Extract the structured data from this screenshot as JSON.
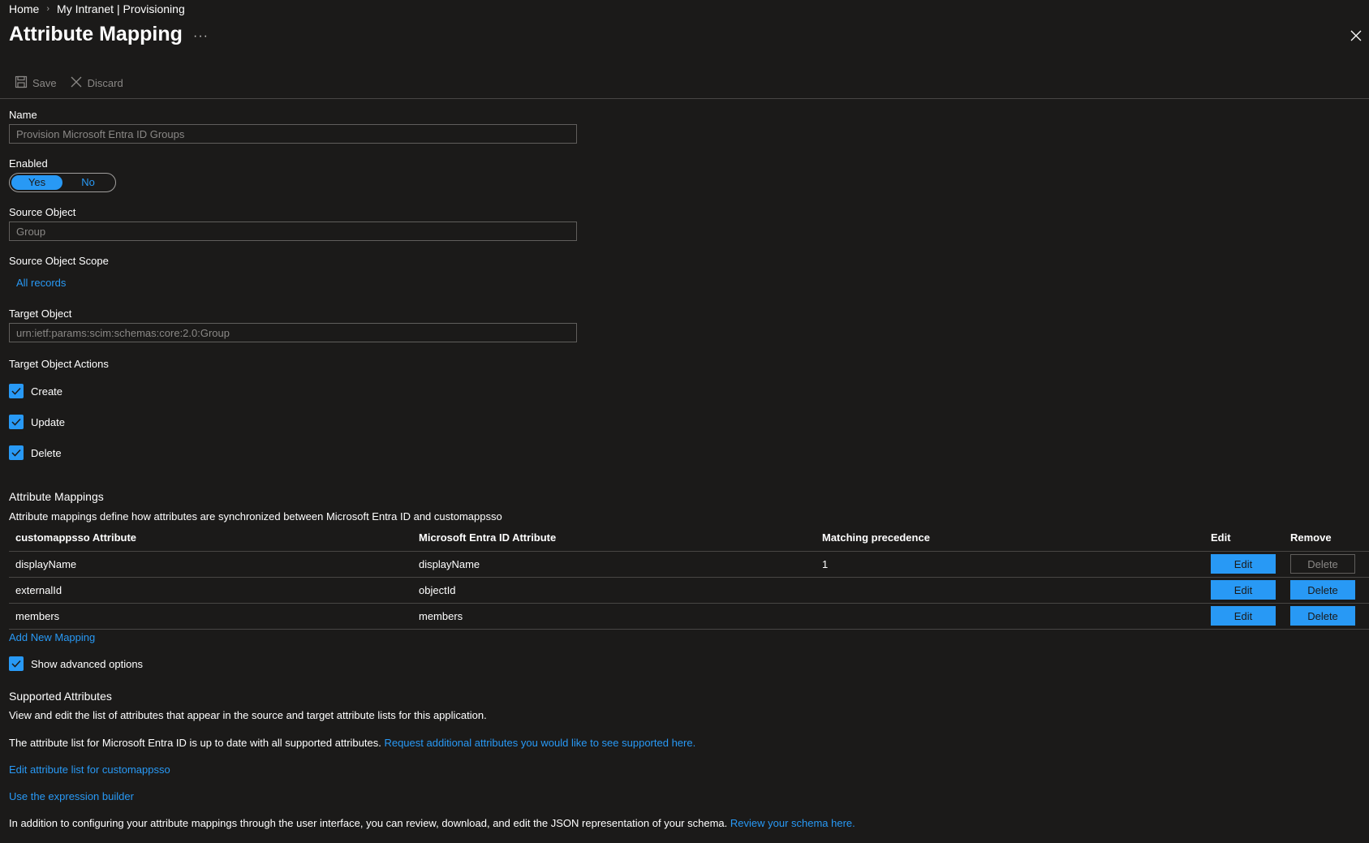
{
  "breadcrumb": {
    "home": "Home",
    "current": "My Intranet | Provisioning",
    "separator": "›"
  },
  "page": {
    "title": "Attribute Mapping",
    "more": "···"
  },
  "toolbar": {
    "save_label": "Save",
    "discard_label": "Discard"
  },
  "form": {
    "name_label": "Name",
    "name_value": "Provision Microsoft Entra ID Groups",
    "enabled_label": "Enabled",
    "enabled_yes": "Yes",
    "enabled_no": "No",
    "enabled_selected": "Yes",
    "source_object_label": "Source Object",
    "source_object_value": "Group",
    "source_scope_label": "Source Object Scope",
    "source_scope_link": "All records",
    "target_object_label": "Target Object",
    "target_object_value": "urn:ietf:params:scim:schemas:core:2.0:Group",
    "target_actions_label": "Target Object Actions",
    "actions": [
      {
        "label": "Create",
        "checked": true
      },
      {
        "label": "Update",
        "checked": true
      },
      {
        "label": "Delete",
        "checked": true
      }
    ]
  },
  "mappings": {
    "title": "Attribute Mappings",
    "description": "Attribute mappings define how attributes are synchronized between Microsoft Entra ID and customappsso",
    "columns": [
      "customappsso Attribute",
      "Microsoft Entra ID Attribute",
      "Matching precedence",
      "Edit",
      "Remove"
    ],
    "rows": [
      {
        "target": "displayName",
        "source": "displayName",
        "precedence": "1",
        "edit": "Edit",
        "remove": "Delete",
        "remove_enabled": false
      },
      {
        "target": "externalId",
        "source": "objectId",
        "precedence": "",
        "edit": "Edit",
        "remove": "Delete",
        "remove_enabled": true
      },
      {
        "target": "members",
        "source": "members",
        "precedence": "",
        "edit": "Edit",
        "remove": "Delete",
        "remove_enabled": true
      }
    ],
    "add_new": "Add New Mapping"
  },
  "advanced": {
    "show_label": "Show advanced options",
    "checked": true,
    "supported_title": "Supported Attributes",
    "supported_desc": "View and edit the list of attributes that appear in the source and target attribute lists for this application.",
    "uptodate_text": "The attribute list for Microsoft Entra ID is up to date with all supported attributes.",
    "request_link": "Request additional attributes you would like to see supported here.",
    "edit_list_link": "Edit attribute list for customappsso",
    "expression_link": "Use the expression builder",
    "schema_text": "In addition to configuring your attribute mappings through the user interface, you can review, download, and edit the JSON representation of your schema.",
    "schema_link": "Review your schema here."
  },
  "colors": {
    "background": "#1b1a19",
    "accent": "#2899f5",
    "muted": "#8a8886",
    "border": "#605e5c"
  }
}
